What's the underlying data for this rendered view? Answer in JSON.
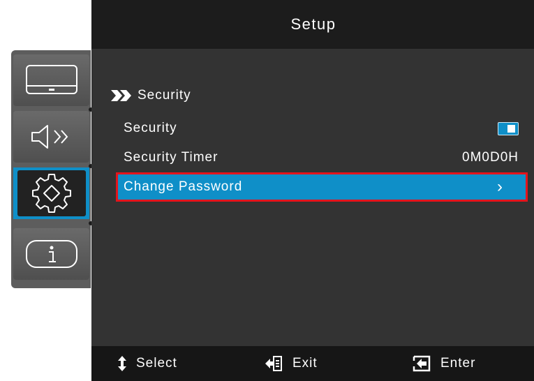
{
  "header": {
    "title": "Setup"
  },
  "sidebar": {
    "items": [
      {
        "icon": "display-icon",
        "selected": false
      },
      {
        "icon": "audio-icon",
        "selected": false
      },
      {
        "icon": "gear-icon",
        "selected": true
      },
      {
        "icon": "info-icon",
        "selected": false
      }
    ]
  },
  "breadcrumb": {
    "label": "Security",
    "icon": "double-chevron-icon"
  },
  "rows": {
    "security": {
      "label": "Security",
      "toggle_on": true
    },
    "security_timer": {
      "label": "Security Timer",
      "value": "0M0D0H"
    },
    "change_password": {
      "label": "Change Password",
      "arrow": "›"
    }
  },
  "footer": {
    "select": "Select",
    "exit": "Exit",
    "enter": "Enter"
  },
  "colors": {
    "accent": "#0f8fc8",
    "highlight_border": "#e3141c",
    "panel": "#333333",
    "header": "#1c1c1c"
  }
}
